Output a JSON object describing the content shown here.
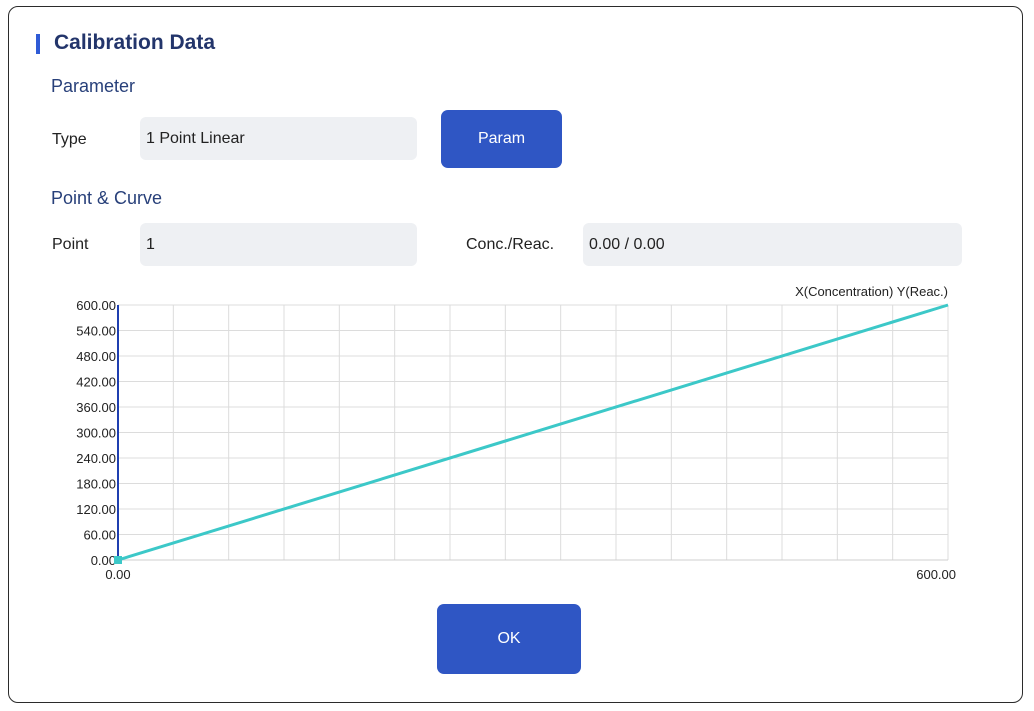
{
  "dialog": {
    "title": "Calibration Data",
    "parameter_section": "Parameter",
    "type_label": "Type",
    "type_value": "1 Point Linear",
    "param_button": "Param",
    "point_section": "Point & Curve",
    "point_label": "Point",
    "point_value": "1",
    "conc_label": "Conc./Reac.",
    "conc_value": "0.00 / 0.00",
    "ok_button": "OK",
    "accent_color": "#2f56c4",
    "title_color": "#23356b"
  },
  "chart_data": {
    "type": "line",
    "legend_text": "X(Concentration) Y(Reac.)",
    "x_tick_labels": [
      "0.00",
      "600.00"
    ],
    "y_tick_labels": [
      "0.00",
      "60.00",
      "120.00",
      "180.00",
      "240.00",
      "300.00",
      "360.00",
      "420.00",
      "480.00",
      "540.00",
      "600.00"
    ],
    "xlim": [
      0,
      600
    ],
    "ylim": [
      0,
      600
    ],
    "grid": true,
    "series": [
      {
        "x": [
          0,
          600
        ],
        "y": [
          0,
          600
        ],
        "color": "#3cc8c8"
      }
    ],
    "marker_points": [
      {
        "x": 0,
        "y": 0
      }
    ]
  }
}
